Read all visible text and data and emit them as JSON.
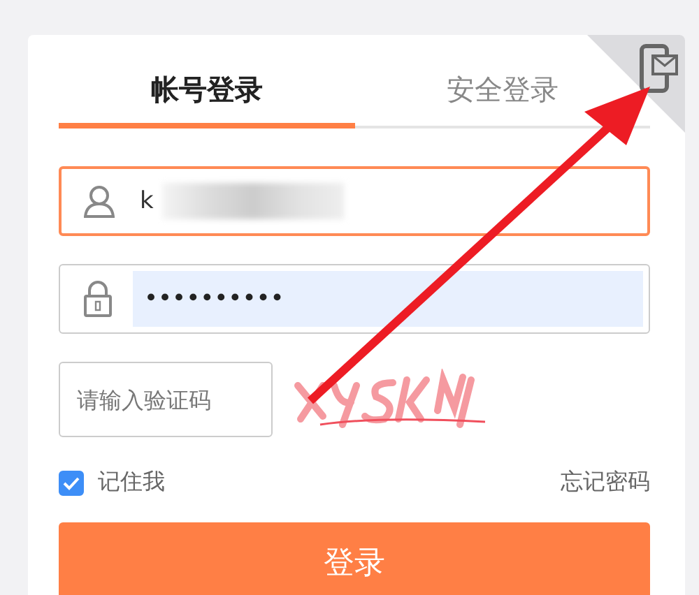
{
  "tabs": [
    {
      "label": "帐号登录",
      "selected": true
    },
    {
      "label": "安全登录",
      "selected": false
    }
  ],
  "username": {
    "value": "k",
    "redacted": true
  },
  "password": {
    "value": "••••••••••",
    "autofilled": true
  },
  "captcha": {
    "placeholder": "请输入验证码"
  },
  "remember": {
    "label": "记住我",
    "checked": true
  },
  "forgot_link": "忘记密码",
  "login_button": "登录"
}
